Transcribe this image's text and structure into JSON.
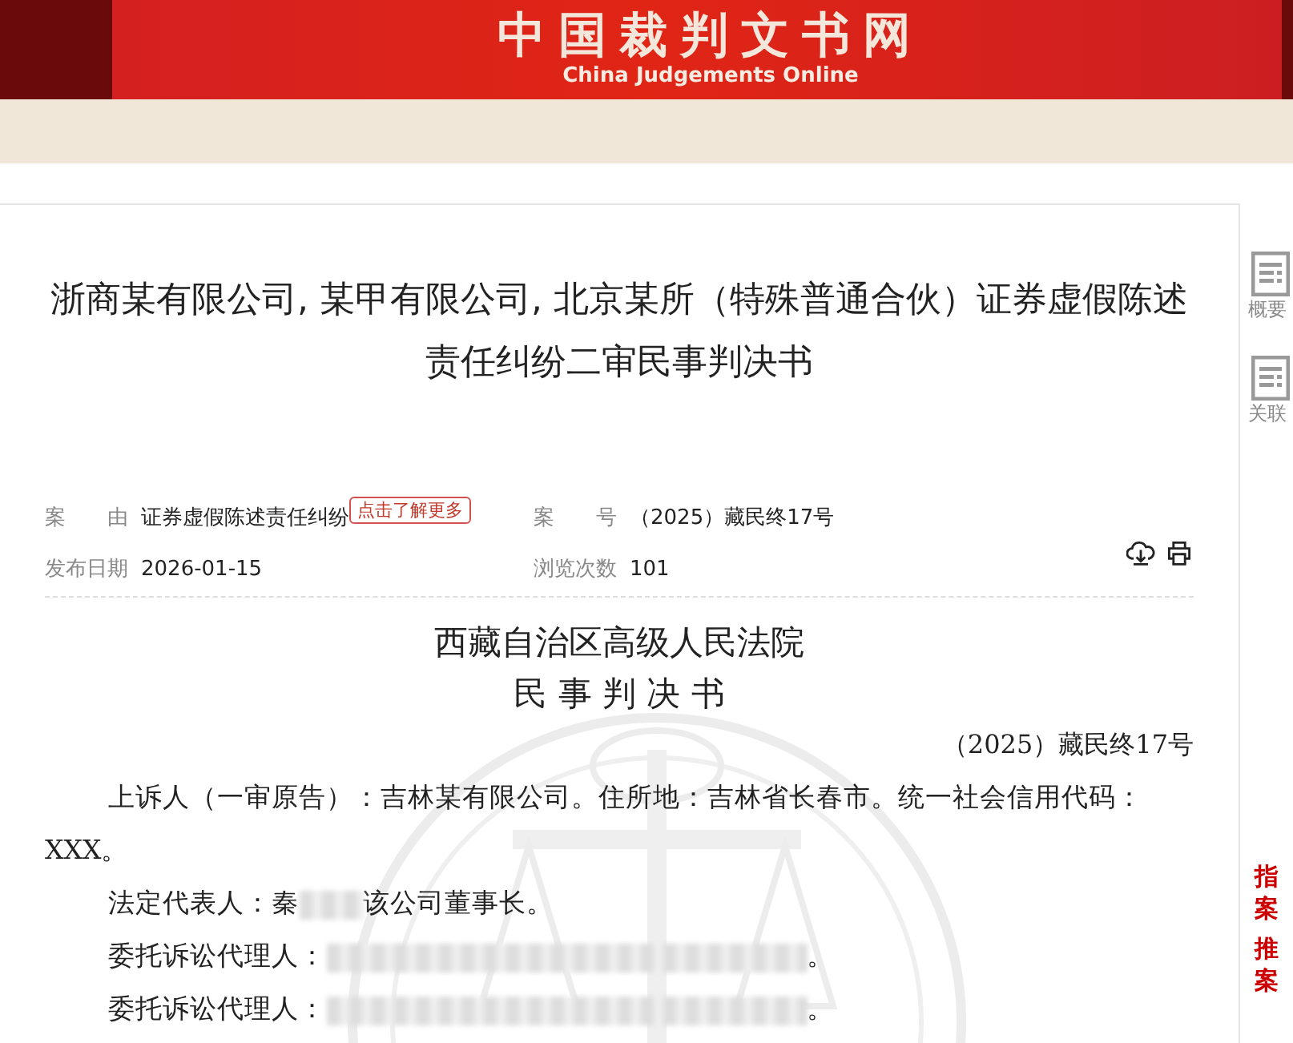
{
  "header": {
    "title": "中国裁判文书网",
    "subtitle": "China Judgements Online"
  },
  "document": {
    "title": "浙商某有限公司, 某甲有限公司, 北京某所（特殊普通合伙）证券虚假陈述责任纠纷二审民事判决书",
    "meta": [
      {
        "label": "案　　由",
        "value": "证券虚假陈述责任纠纷",
        "tag": "点击了解更多"
      },
      {
        "label": "案　　号",
        "value": "（2025）藏民终17号"
      },
      {
        "label": "发布日期",
        "value": "2026-01-15"
      },
      {
        "label": "浏览次数",
        "value": "101"
      }
    ],
    "court": "西藏自治区高级人民法院",
    "doc_type": "民 事 判 决 书",
    "case_number": "（2025）藏民终17号",
    "paragraphs": [
      {
        "parts": [
          {
            "kind": "text",
            "text": "上诉人（一审原告）：吉林某有限公司。住所地：吉林省长春市。统一社会信用代码：XXX。"
          }
        ]
      },
      {
        "parts": [
          {
            "kind": "text",
            "text": "法定代表人：秦"
          },
          {
            "kind": "redacted"
          },
          {
            "kind": "text",
            "text": "该公司董事长。"
          }
        ]
      },
      {
        "parts": [
          {
            "kind": "text",
            "text": "委托诉讼代理人："
          },
          {
            "kind": "redacted"
          },
          {
            "kind": "text",
            "text": "。"
          }
        ]
      },
      {
        "parts": [
          {
            "kind": "text",
            "text": "委托诉讼代理人："
          },
          {
            "kind": "redacted"
          },
          {
            "kind": "text",
            "text": "。"
          }
        ]
      }
    ]
  },
  "side_tools": [
    {
      "label": "概要"
    },
    {
      "label": "关联"
    }
  ],
  "side_links": [
    {
      "lines": [
        "指",
        "案"
      ]
    },
    {
      "lines": [
        "推",
        "案"
      ]
    }
  ]
}
